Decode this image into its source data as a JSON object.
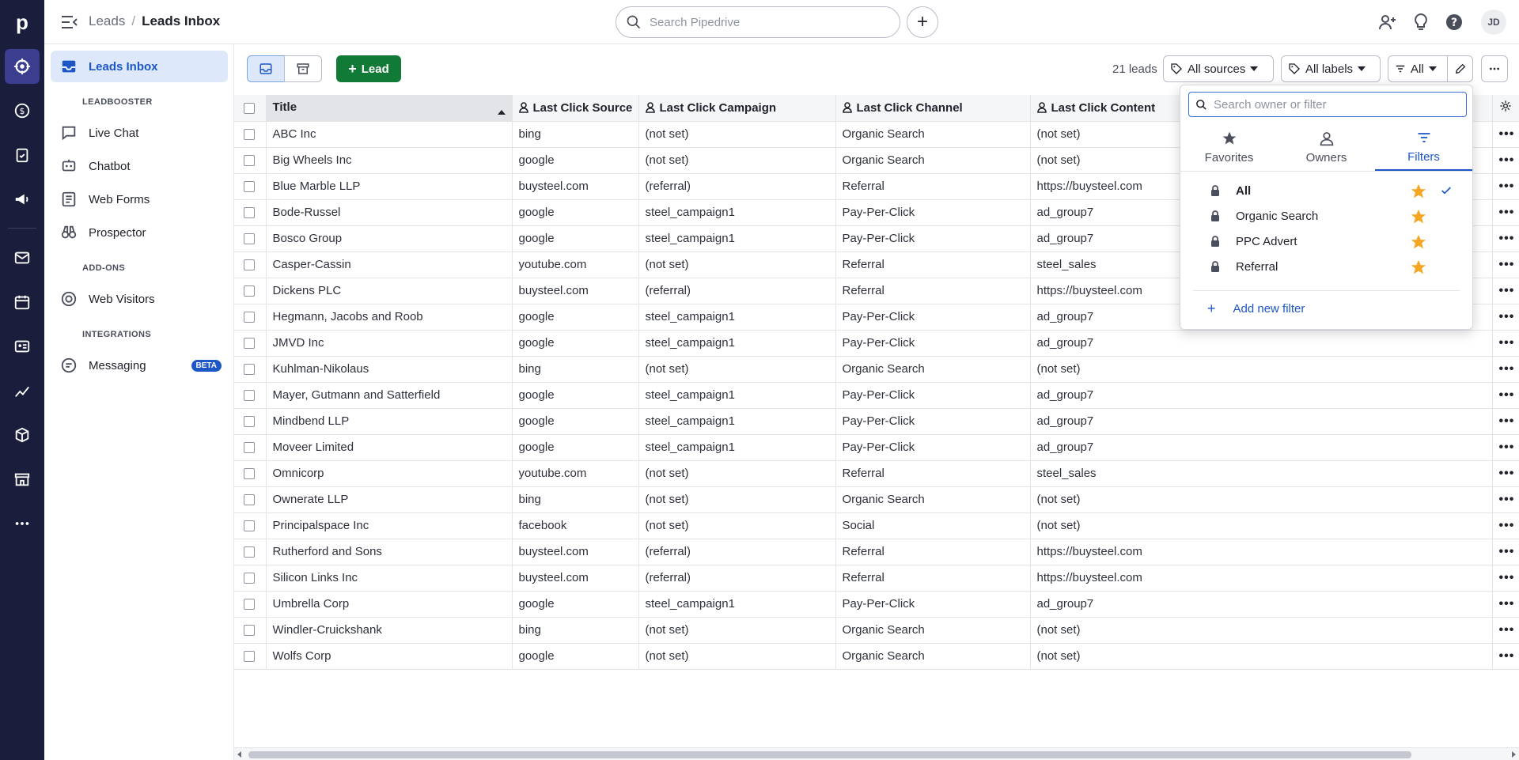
{
  "app": {
    "logo": "p",
    "avatar_initials": "JD"
  },
  "breadcrumb": {
    "parent": "Leads",
    "separator": "/",
    "current": "Leads Inbox"
  },
  "search": {
    "placeholder": "Search Pipedrive",
    "value": ""
  },
  "add_button": "+",
  "sidebar": {
    "leads_inbox": "Leads Inbox",
    "sections": [
      {
        "heading": "LEADBOOSTER",
        "items": [
          "Live Chat",
          "Chatbot",
          "Web Forms",
          "Prospector"
        ]
      },
      {
        "heading": "ADD-ONS",
        "items": [
          "Web Visitors"
        ]
      },
      {
        "heading": "INTEGRATIONS",
        "items": [
          "Messaging"
        ]
      }
    ],
    "beta_badge": "BETA"
  },
  "toolbar": {
    "lead_button": "Lead",
    "lead_count": "21 leads",
    "all_sources": "All sources",
    "all_labels": "All labels",
    "all_filter": "All"
  },
  "table": {
    "columns": [
      "Title",
      "Last Click Source",
      "Last Click Campaign",
      "Last Click Channel",
      "Last Click Content"
    ],
    "rows": [
      [
        "ABC Inc",
        "bing",
        "(not set)",
        "Organic Search",
        "(not set)"
      ],
      [
        "Big Wheels Inc",
        "google",
        "(not set)",
        "Organic Search",
        "(not set)"
      ],
      [
        "Blue Marble LLP",
        "buysteel.com",
        "(referral)",
        "Referral",
        "https://buysteel.com"
      ],
      [
        "Bode-Russel",
        "google",
        "steel_campaign1",
        "Pay-Per-Click",
        "ad_group7"
      ],
      [
        "Bosco Group",
        "google",
        "steel_campaign1",
        "Pay-Per-Click",
        "ad_group7"
      ],
      [
        "Casper-Cassin",
        "youtube.com",
        "(not set)",
        "Referral",
        "steel_sales"
      ],
      [
        "Dickens PLC",
        "buysteel.com",
        "(referral)",
        "Referral",
        "https://buysteel.com"
      ],
      [
        "Hegmann, Jacobs and Roob",
        "google",
        "steel_campaign1",
        "Pay-Per-Click",
        "ad_group7"
      ],
      [
        "JMVD Inc",
        "google",
        "steel_campaign1",
        "Pay-Per-Click",
        "ad_group7"
      ],
      [
        "Kuhlman-Nikolaus",
        "bing",
        "(not set)",
        "Organic Search",
        "(not set)"
      ],
      [
        "Mayer, Gutmann and Satterfield",
        "google",
        "steel_campaign1",
        "Pay-Per-Click",
        "ad_group7"
      ],
      [
        "Mindbend LLP",
        "google",
        "steel_campaign1",
        "Pay-Per-Click",
        "ad_group7"
      ],
      [
        "Moveer Limited",
        "google",
        "steel_campaign1",
        "Pay-Per-Click",
        "ad_group7"
      ],
      [
        "Omnicorp",
        "youtube.com",
        "(not set)",
        "Referral",
        "steel_sales"
      ],
      [
        "Ownerate LLP",
        "bing",
        "(not set)",
        "Organic Search",
        "(not set)"
      ],
      [
        "Principalspace Inc",
        "facebook",
        "(not set)",
        "Social",
        "(not set)"
      ],
      [
        "Rutherford and Sons",
        "buysteel.com",
        "(referral)",
        "Referral",
        "https://buysteel.com"
      ],
      [
        "Silicon Links Inc",
        "buysteel.com",
        "(referral)",
        "Referral",
        "https://buysteel.com"
      ],
      [
        "Umbrella Corp",
        "google",
        "steel_campaign1",
        "Pay-Per-Click",
        "ad_group7"
      ],
      [
        "Windler-Cruickshank",
        "bing",
        "(not set)",
        "Organic Search",
        "(not set)"
      ],
      [
        "Wolfs Corp",
        "google",
        "(not set)",
        "Organic Search",
        "(not set)"
      ]
    ],
    "row_menu": "•••"
  },
  "filter_popup": {
    "search_placeholder": "Search owner or filter",
    "tabs": [
      "Favorites",
      "Owners",
      "Filters"
    ],
    "active_tab": "Filters",
    "items": [
      "All",
      "Organic Search",
      "PPC Advert",
      "Referral"
    ],
    "selected": "All",
    "add_new": "Add new filter"
  },
  "colors": {
    "nav_bg": "#1b1d3c",
    "accent": "#1d56c7",
    "lead_green": "#117a37",
    "star": "#f5a623"
  }
}
